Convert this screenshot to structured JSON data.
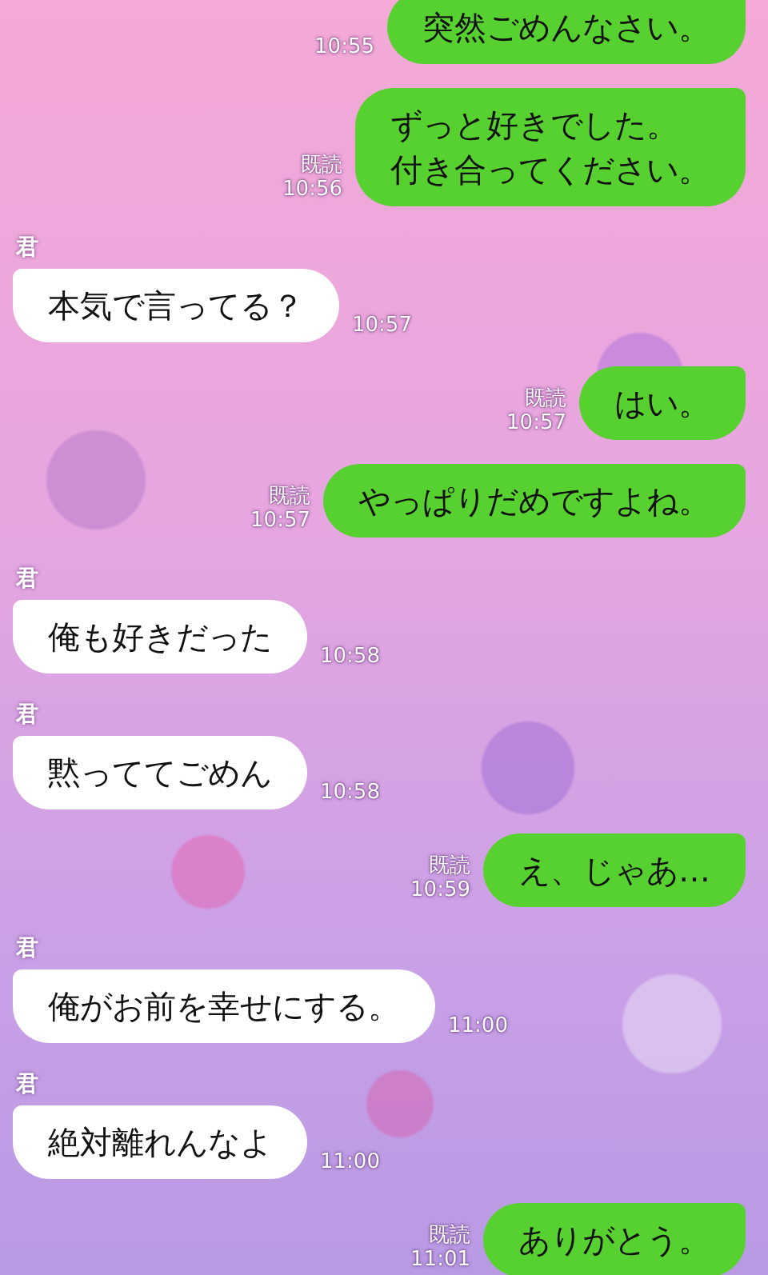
{
  "messages": [
    {
      "kind": "sent",
      "lines": [
        "突然ごめんなさい。"
      ],
      "time": "10:55"
    },
    {
      "kind": "sent",
      "lines": [
        "ずっと好きでした。",
        "付き合ってください。"
      ],
      "read_label": "既読",
      "time": "10:56"
    },
    {
      "kind": "received",
      "sender": "君",
      "text": "本気で言ってる？",
      "time": "10:57"
    },
    {
      "kind": "sent",
      "lines": [
        "はい。"
      ],
      "read_label": "既読",
      "time": "10:57"
    },
    {
      "kind": "sent",
      "lines": [
        "やっぱりだめですよね。"
      ],
      "read_label": "既読",
      "time": "10:57"
    },
    {
      "kind": "received",
      "sender": "君",
      "text": "俺も好きだった",
      "time": "10:58"
    },
    {
      "kind": "received",
      "sender": "君",
      "text": "黙っててごめん",
      "time": "10:58"
    },
    {
      "kind": "sent",
      "lines": [
        "え、じゃあ…"
      ],
      "read_label": "既読",
      "time": "10:59"
    },
    {
      "kind": "received",
      "sender": "君",
      "text": "俺がお前を幸せにする。",
      "time": "11:00"
    },
    {
      "kind": "received",
      "sender": "君",
      "text": "絶対離れんなよ",
      "time": "11:00"
    },
    {
      "kind": "sent",
      "lines": [
        "ありがとう。"
      ],
      "read_label": "既読",
      "time": "11:01"
    }
  ]
}
